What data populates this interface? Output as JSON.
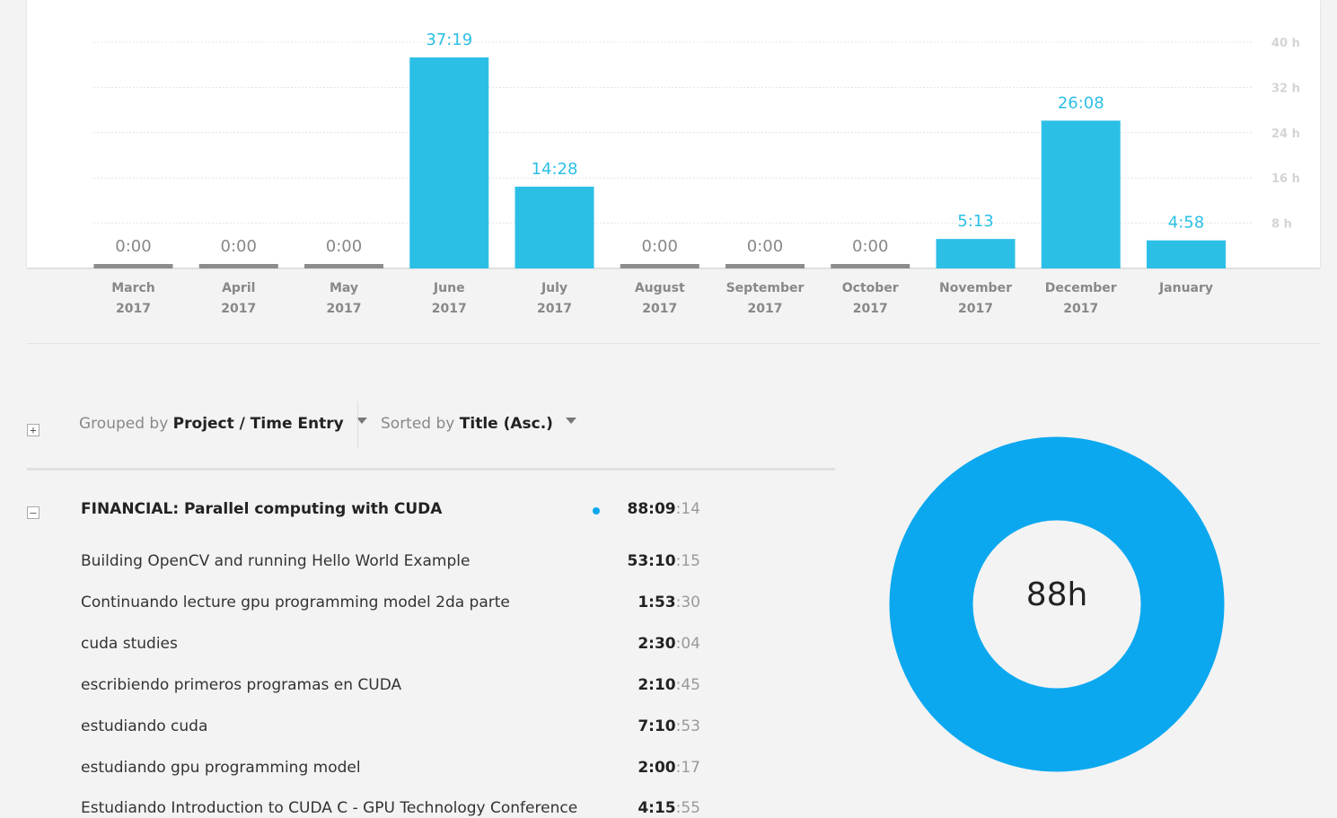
{
  "chart_data": {
    "type": "bar",
    "categories": [
      "March 2017",
      "April 2017",
      "May 2017",
      "June 2017",
      "July 2017",
      "August 2017",
      "September 2017",
      "October 2017",
      "November 2017",
      "December 2017",
      "January"
    ],
    "month_labels": [
      "March",
      "April",
      "May",
      "June",
      "July",
      "August",
      "September",
      "October",
      "November",
      "December",
      "January"
    ],
    "year_labels": [
      "2017",
      "2017",
      "2017",
      "2017",
      "2017",
      "2017",
      "2017",
      "2017",
      "2017",
      "2017",
      ""
    ],
    "values": [
      0,
      0,
      0,
      37.3167,
      14.4667,
      0,
      0,
      0,
      5.2167,
      26.1333,
      4.9667
    ],
    "value_labels": [
      "0:00",
      "0:00",
      "0:00",
      "37:19",
      "14:28",
      "0:00",
      "0:00",
      "0:00",
      "5:13",
      "26:08",
      "4:58"
    ],
    "y_ticks": [
      8,
      16,
      24,
      32,
      40
    ],
    "y_tick_labels": [
      "8 h",
      "16 h",
      "24 h",
      "32 h",
      "40 h"
    ],
    "ylim": [
      0,
      40
    ],
    "grid": true,
    "colors": {
      "bar": "#2cbfe6",
      "zero_bar": "#8c8c8c",
      "value_label": "#2cbfe6",
      "zero_label": "#888888"
    }
  },
  "controls": {
    "grouped_prefix": "Grouped by ",
    "grouped_value": "Project / Time Entry",
    "sorted_prefix": "Sorted by ",
    "sorted_value": "Title (Asc.)",
    "expand_symbol": "+",
    "collapse_symbol": "–"
  },
  "project": {
    "title": "FINANCIAL: Parallel computing with CUDA",
    "duration_main": "88:09",
    "duration_sec": ":14",
    "dot_color": "#0ba8f0"
  },
  "entries": [
    {
      "title": "Building OpenCV and running Hello World Example",
      "duration_main": "53:10",
      "duration_sec": ":15"
    },
    {
      "title": "Continuando lecture gpu programming model 2da parte",
      "duration_main": "1:53",
      "duration_sec": ":30"
    },
    {
      "title": "cuda studies",
      "duration_main": "2:30",
      "duration_sec": ":04"
    },
    {
      "title": "escribiendo primeros programas en CUDA",
      "duration_main": "2:10",
      "duration_sec": ":45"
    },
    {
      "title": "estudiando cuda",
      "duration_main": "7:10",
      "duration_sec": ":53"
    },
    {
      "title": "estudiando gpu programming model",
      "duration_main": "2:00",
      "duration_sec": ":17"
    },
    {
      "title": "Estudiando Introduction to CUDA C - GPU Technology Conference",
      "duration_main": "4:15",
      "duration_sec": ":55"
    }
  ],
  "donut": {
    "total_label": "88h",
    "color": "#0ba8f0",
    "fraction": 1.0
  }
}
